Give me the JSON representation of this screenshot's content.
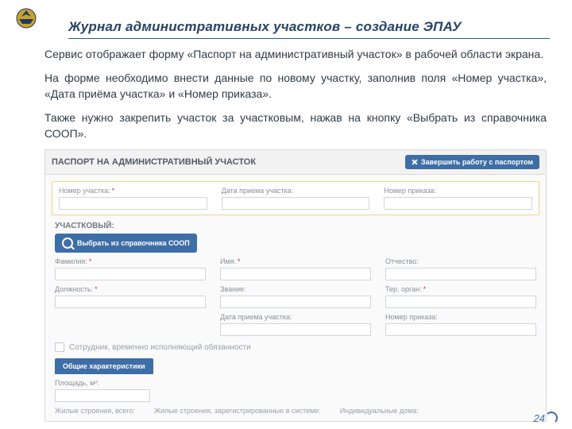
{
  "title": "Журнал административных участков – создание ЭПАУ",
  "paragraphs": [
    "Сервис отображает форму «Паспорт на административный участок» в рабочей области экрана.",
    "На форме необходимо внести данные по новому участку, заполнив поля «Номер участка», «Дата приёма участка» и «Номер приказа».",
    "Также нужно закрепить участок за участковым, нажав на кнопку «Выбрать из справочника СООП»."
  ],
  "app": {
    "heading": "ПАСПОРТ НА АДМИНИСТРАТИВНЫЙ УЧАСТОК",
    "close_label": "Завершить работу с паспортом",
    "top_fields": {
      "number_label": "Номер участка:",
      "date_label": "Дата приема участка:",
      "order_label": "Номер приказа:"
    },
    "officer_section": "УЧАСТКОВЫЙ:",
    "soop_button": "Выбрать из справочника СООП",
    "officer_fields": {
      "lastname": "Фамилия:",
      "firstname": "Имя:",
      "middlename": "Отчество:",
      "position": "Должность:",
      "rank": "Звание:",
      "agency": "Тер. орган:",
      "date": "Дата приема участка:",
      "order": "Номер приказа:"
    },
    "temp_checkbox": "Сотрудник, временно исполняющий обязанности",
    "tab": "Общие характеристики",
    "area_label": "Площадь, м²:",
    "footer": {
      "buildings_total": "Жилые строения, всего:",
      "buildings_registered": "Жилые строения, зарегистрированные в системе:",
      "individual": "Индивидуальные дома:"
    }
  },
  "page_number": "24"
}
